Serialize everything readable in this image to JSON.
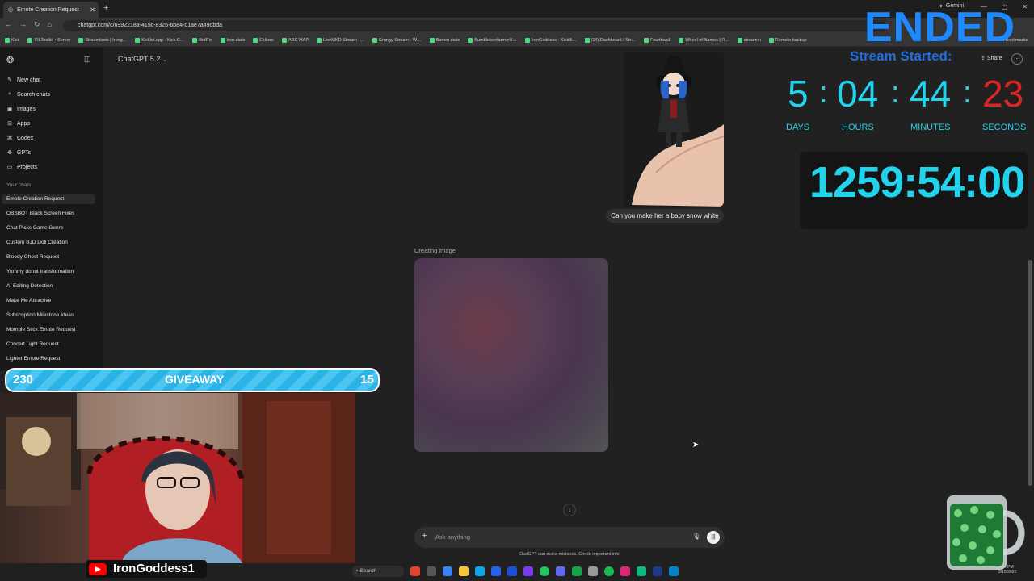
{
  "browser": {
    "tab_title": "Emote Creation Request",
    "url": "chatgpt.com/c/6992218a-415c-8325-bb84-d1ae7a49dbda",
    "gemini_label": "Gemini",
    "bookmarks": [
      "Kick",
      "IRLToolkit • Server",
      "Streamloots | Irong…",
      "Kicklet.app - Kick C…",
      "BotRix",
      "Iron stats",
      "Eklipse",
      "ARC MAP",
      "LinnMKD Stream -…",
      "Grungy Stream - W…",
      "Barren stats",
      "Bumblebeefarmer8…",
      "IronGoddess - KickB…",
      "(14) Dashboard / Str…",
      "Fourthwall",
      "Wheel of Names | R…",
      "streamin",
      "Remote backup"
    ],
    "all_bookmarks": "All Bookmarks",
    "accent_color": "#4ade80"
  },
  "header": {
    "model": "ChatGPT 5.2",
    "share": "Share"
  },
  "sidebar": {
    "nav": [
      {
        "icon": "edit-icon",
        "label": "New chat"
      },
      {
        "icon": "search-icon",
        "label": "Search chats"
      },
      {
        "icon": "image-icon",
        "label": "Images"
      },
      {
        "icon": "apps-icon",
        "label": "Apps"
      },
      {
        "icon": "codex-icon",
        "label": "Codex"
      },
      {
        "icon": "gpts-icon",
        "label": "GPTs"
      },
      {
        "icon": "folder-icon",
        "label": "Projects"
      }
    ],
    "chats_label": "Your chats",
    "chats": [
      "Emote Creation Request",
      "OBSBOT Black Screen Fixes",
      "Chat Picks Game Genre",
      "Custom BJD Doll Creation",
      "Bloody Ghost Request",
      "Yummy donut transformation",
      "AI Editing Detection",
      "Make Me Attractive",
      "Subscription Milestone Ideas",
      "Mombie Stick Emote Request",
      "Concert Light Request",
      "Lighter Emote Request"
    ]
  },
  "conversation": {
    "user_message": "Can you make her a baby snow white",
    "status": "Creating image"
  },
  "composer": {
    "placeholder": "Ask anything",
    "disclaimer": "ChatGPT can make mistakes. Check important info."
  },
  "taskbar": {
    "search": "Search",
    "time": "4:54 PM",
    "date": "2/15/2026"
  },
  "overlay": {
    "ended": "ENDED",
    "stream_started": "Stream Started:",
    "countdown": {
      "days": "5",
      "hours": "04",
      "minutes": "44",
      "seconds": "23",
      "labels": [
        "DAYS",
        "HOURS",
        "MINUTES",
        "SECONDS"
      ]
    },
    "timer": "1259:54:00",
    "giveaway": {
      "left": "230",
      "title": "GIVEAWAY",
      "right": "15"
    },
    "channel": "IronGoddess1",
    "colors": {
      "ended": "#1e88ff",
      "countdown": "#22d3ee",
      "seconds": "#dc2626"
    }
  }
}
